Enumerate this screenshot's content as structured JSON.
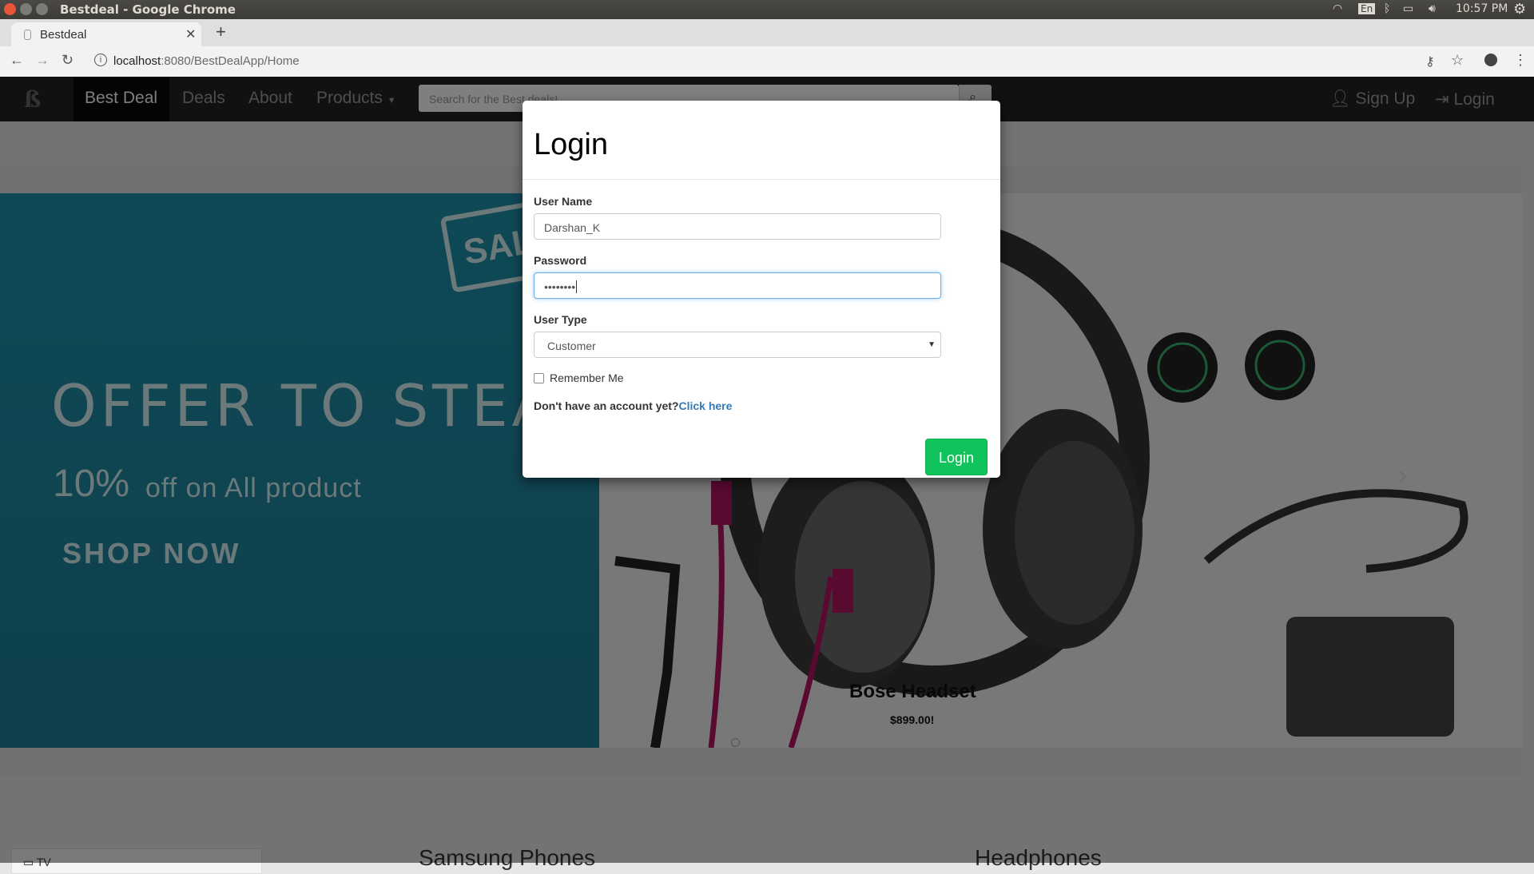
{
  "os": {
    "window_title": "Bestdeal - Google Chrome",
    "lang": "En",
    "time": "10:57 PM"
  },
  "browser": {
    "tab_title": "Bestdeal",
    "url_host": "localhost",
    "url_rest": ":8080/BestDealApp/Home"
  },
  "site_nav": {
    "brand": "Best Deal",
    "links": [
      "Deals",
      "About",
      "Products"
    ],
    "search_placeholder": "Search for the Best deals!",
    "signup": "Sign Up",
    "login": "Login"
  },
  "hero": {
    "headline": "OFFER TO STEAL",
    "sale_badge": "SALE",
    "discount_pct": "10%",
    "discount_rest": "off on All product",
    "cta": "SHOP NOW",
    "caption_title": "Bose Headset",
    "caption_price": "$899.00!"
  },
  "below": {
    "category": "TV",
    "section1": "Samsung Phones",
    "section2": "Headphones"
  },
  "modal": {
    "title": "Login",
    "username_label": "User Name",
    "username_value": "Darshan_K",
    "password_label": "Password",
    "password_value": "••••••••",
    "usertype_label": "User Type",
    "usertype_value": "Customer",
    "remember_label": "Remember Me",
    "no_account_text": "Don't have an account yet?",
    "click_here": "Click here",
    "login_button": "Login"
  }
}
